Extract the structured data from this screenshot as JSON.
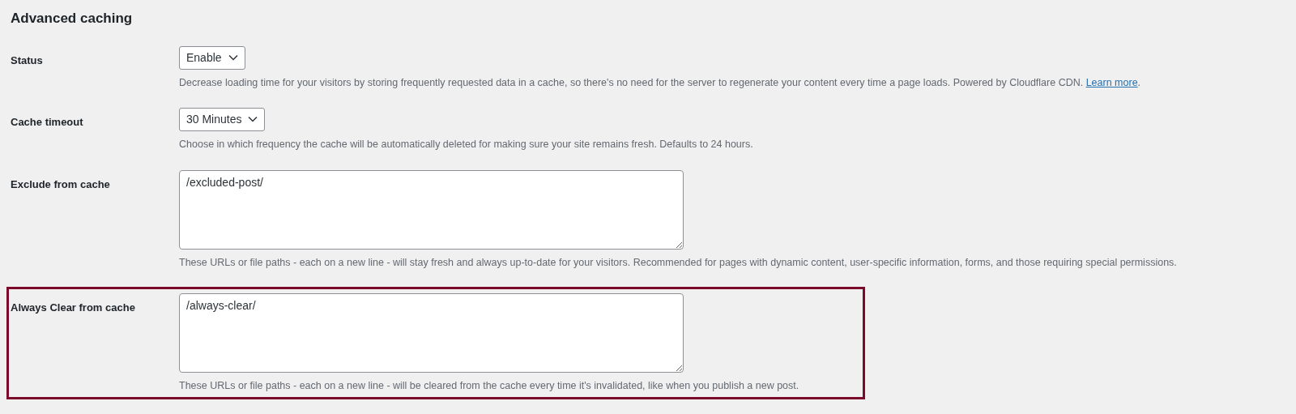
{
  "title": "Advanced caching",
  "rows": [
    {
      "label": "Status",
      "kind": "select",
      "value": "Enable",
      "description": "Decrease loading time for your visitors by storing frequently requested data in a cache, so there's no need for the server to regenerate your content every time a page loads. Powered by Cloudflare CDN.",
      "link": "Learn more",
      "after_link": ".",
      "highlighted": false
    },
    {
      "label": "Cache timeout",
      "kind": "select",
      "value": "30 Minutes",
      "description": "Choose in which frequency the cache will be automatically deleted for making sure your site remains fresh. Defaults to 24 hours.",
      "highlighted": false
    },
    {
      "label": "Exclude from cache",
      "kind": "textarea",
      "value": "/excluded-post/",
      "description": "These URLs or file paths - each on a new line - will stay fresh and always up-to-date for your visitors. Recommended for pages with dynamic content, user-specific information, forms, and those requiring special permissions.",
      "highlighted": false
    },
    {
      "label": "Always Clear from cache",
      "kind": "textarea",
      "value": "/always-clear/",
      "description": "These URLs or file paths - each on a new line - will be cleared from the cache every time it's invalidated, like when you publish a new post.",
      "highlighted": true
    }
  ]
}
